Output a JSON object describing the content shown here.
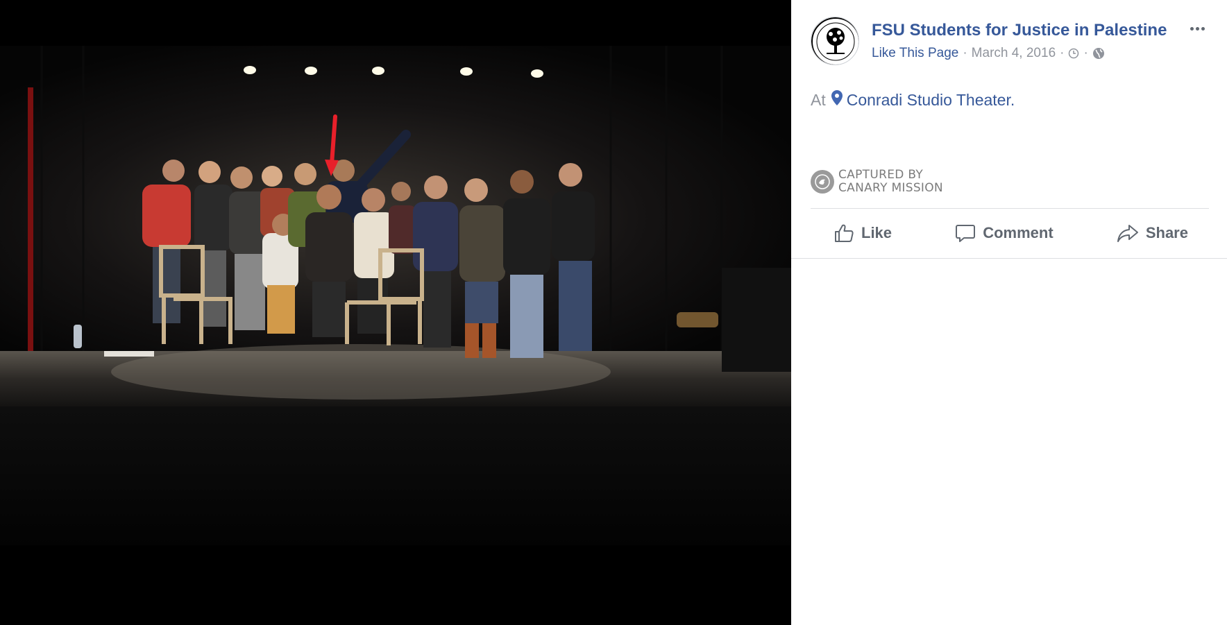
{
  "post": {
    "page_name": "FSU Students for Justice in Palestine",
    "like_page_label": "Like This Page",
    "separator": "·",
    "date": "March 4, 2016",
    "clock_icon": "clock-icon",
    "audience_icon": "globe-icon",
    "more_icon": "more-options-icon",
    "location_prefix": "At",
    "location_icon": "map-pin-icon",
    "location_name": "Conradi Studio Theater."
  },
  "watermark": {
    "line1": "CAPTURED BY",
    "line2": "CANARY MISSION",
    "icon": "canary-bird-icon"
  },
  "actions": {
    "like": "Like",
    "comment": "Comment",
    "share": "Share"
  },
  "photo": {
    "alt_icon": "group-photo-on-stage",
    "annotation_icon": "red-arrow-icon"
  },
  "colors": {
    "link": "#365899",
    "meta_gray": "#90949c",
    "action_gray": "#606770",
    "viewer_bg": "#000000",
    "arrow_red": "#e8202a"
  }
}
